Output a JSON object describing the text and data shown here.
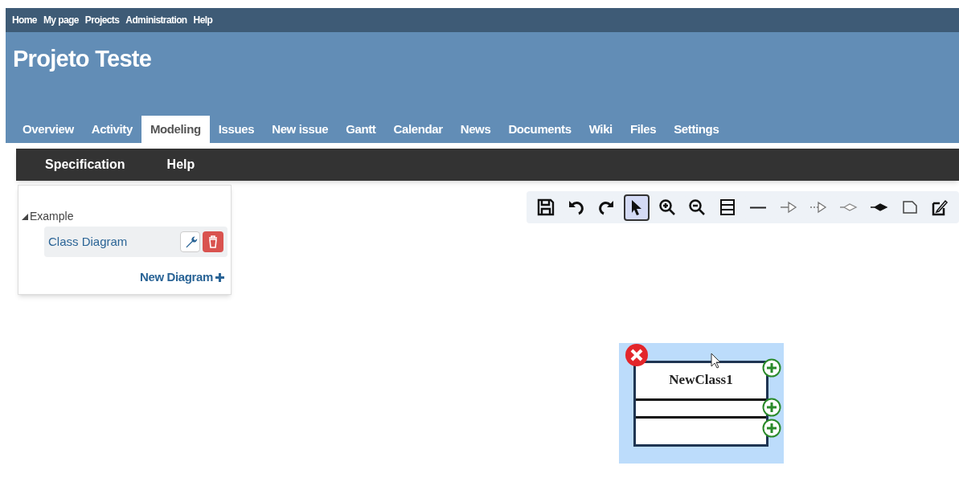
{
  "top_menu": [
    "Home",
    "My page",
    "Projects",
    "Administration",
    "Help"
  ],
  "project_title": "Projeto Teste",
  "tabs": [
    {
      "label": "Overview",
      "selected": false
    },
    {
      "label": "Activity",
      "selected": false
    },
    {
      "label": "Modeling",
      "selected": true
    },
    {
      "label": "Issues",
      "selected": false
    },
    {
      "label": "New issue",
      "selected": false
    },
    {
      "label": "Gantt",
      "selected": false
    },
    {
      "label": "Calendar",
      "selected": false
    },
    {
      "label": "News",
      "selected": false
    },
    {
      "label": "Documents",
      "selected": false
    },
    {
      "label": "Wiki",
      "selected": false
    },
    {
      "label": "Files",
      "selected": false
    },
    {
      "label": "Settings",
      "selected": false
    }
  ],
  "sub_menu": [
    "Specification",
    "Help"
  ],
  "tree": {
    "label": "Example",
    "expanded": true,
    "children": [
      {
        "label": "Class Diagram",
        "selected": true
      }
    ]
  },
  "new_diagram": "New Diagram",
  "toolbar": [
    {
      "kind": "save",
      "selected": false
    },
    {
      "kind": "undo",
      "selected": false
    },
    {
      "kind": "redo",
      "selected": false
    },
    {
      "kind": "select",
      "selected": true
    },
    {
      "kind": "zoom-in",
      "selected": false
    },
    {
      "kind": "zoom-out",
      "selected": false
    },
    {
      "kind": "class",
      "selected": false
    },
    {
      "kind": "association",
      "selected": false
    },
    {
      "kind": "generalization",
      "selected": false
    },
    {
      "kind": "realization",
      "selected": false
    },
    {
      "kind": "aggregation",
      "selected": false
    },
    {
      "kind": "composition",
      "selected": false
    },
    {
      "kind": "note",
      "selected": false
    },
    {
      "kind": "edit",
      "selected": false
    }
  ],
  "class_shape": {
    "name": "NewClass1",
    "selected": true
  }
}
